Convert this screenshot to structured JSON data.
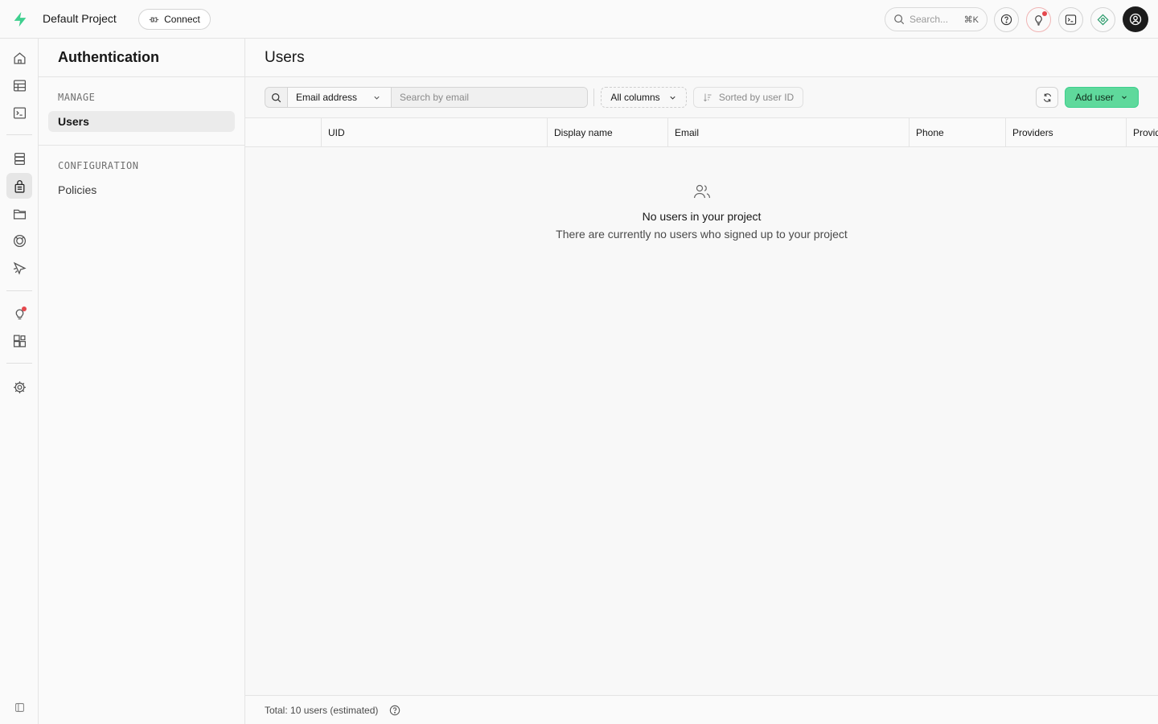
{
  "topbar": {
    "project_name": "Default Project",
    "connect_label": "Connect",
    "search_placeholder": "Search...",
    "search_shortcut": "⌘K",
    "icons": [
      "help-icon",
      "lightbulb-icon",
      "terminal-icon",
      "assistant-icon",
      "avatar"
    ]
  },
  "rail": {
    "items": [
      "home-icon",
      "table-editor-icon",
      "sql-editor-icon",
      "database-icon",
      "authentication-icon",
      "storage-icon",
      "realtime-icon",
      "edge-functions-icon",
      "advisors-icon",
      "integrations-icon",
      "settings-icon",
      "collapse-sidebar-icon"
    ],
    "active": "authentication-icon"
  },
  "sidemenu": {
    "title": "Authentication",
    "groups": [
      {
        "label": "MANAGE",
        "items": [
          {
            "label": "Users",
            "active": true
          }
        ]
      },
      {
        "label": "CONFIGURATION",
        "items": [
          {
            "label": "Policies",
            "active": false
          }
        ]
      }
    ]
  },
  "page": {
    "title": "Users",
    "filter_column": "Email address",
    "search_placeholder": "Search by email",
    "columns_label": "All columns",
    "sort_label": "Sorted by user ID",
    "add_user_label": "Add user",
    "table_columns": [
      "UID",
      "Display name",
      "Email",
      "Phone",
      "Providers",
      "Provid"
    ],
    "empty_title": "No users in your project",
    "empty_description": "There are currently no users who signed up to your project",
    "footer_total": "Total: 10 users (estimated)"
  },
  "colors": {
    "brand": "#3ecf8e",
    "add_user_bg": "#5fd99c",
    "notification_dot": "#e5484d"
  }
}
